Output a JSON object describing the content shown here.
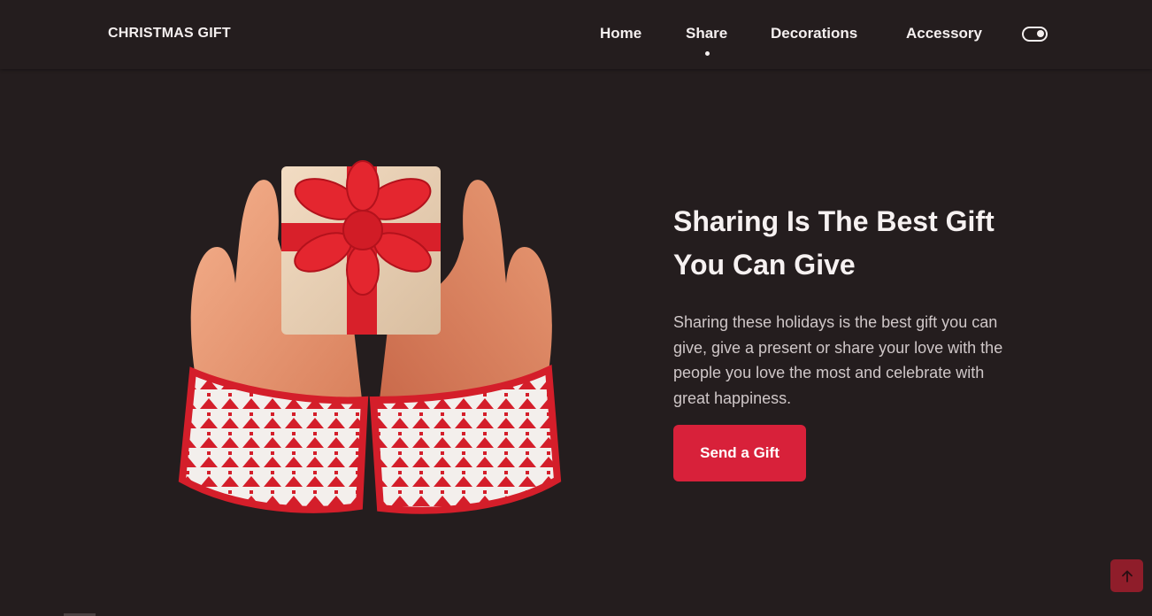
{
  "header": {
    "logo": "CHRISTMAS GIFT",
    "nav": [
      {
        "label": "Home"
      },
      {
        "label": "Share",
        "active": true
      },
      {
        "label": "Decorations"
      },
      {
        "label": "Accessory"
      }
    ],
    "theme_toggle_icon": "toggle-on-icon"
  },
  "hero": {
    "image_icon": "hands-holding-gift-image",
    "title": "Sharing Is The Best Gift You Can Give",
    "description": "Sharing these holidays is the best gift you can give, give a present or share your love with the people you love the most and celebrate with great happiness.",
    "button_label": "Send a Gift"
  },
  "scroll_up_icon": "arrow-up-icon",
  "colors": {
    "background": "#241d1e",
    "accent": "#d8213a",
    "scroll_button": "#8f1d2a",
    "text": "#f4efef"
  }
}
